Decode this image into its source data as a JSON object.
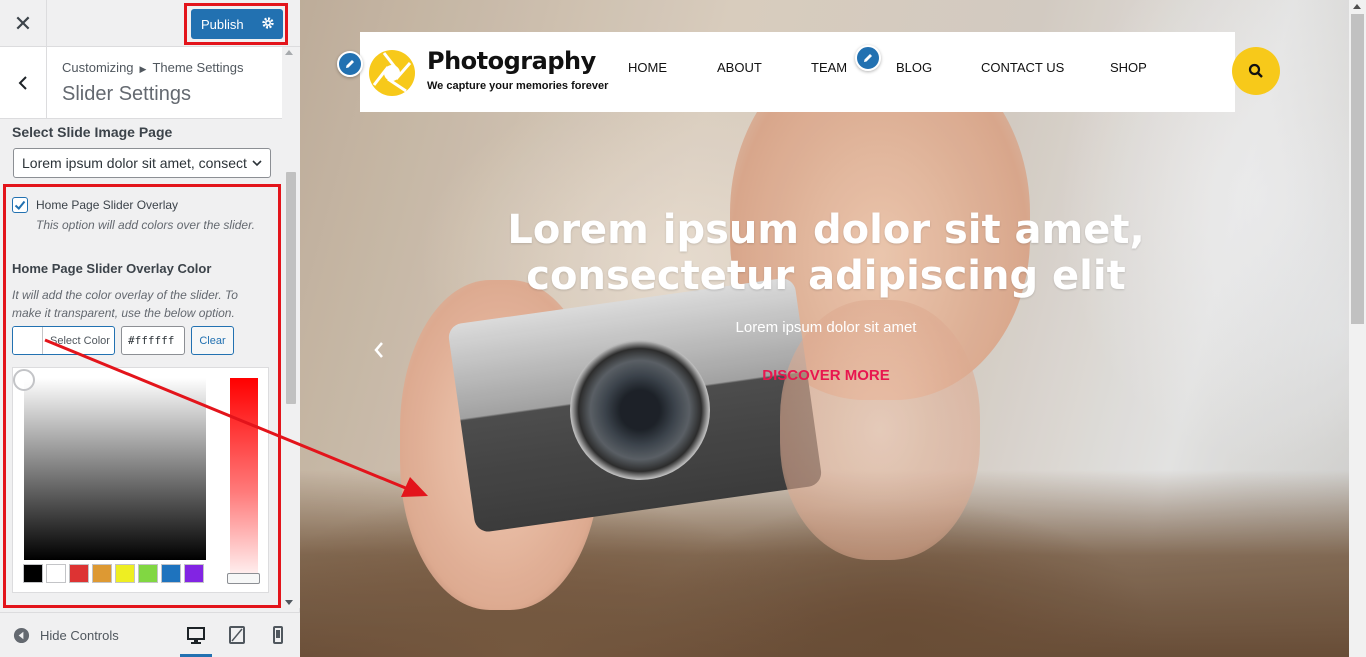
{
  "customizer": {
    "close_icon": "close-icon",
    "publish_label": "Publish",
    "breadcrumb": {
      "root": "Customizing",
      "section": "Theme Settings"
    },
    "section_title": "Slider Settings",
    "slide_page": {
      "label": "Select Slide Image Page",
      "selected": "Lorem ipsum dolor sit amet, consect"
    },
    "overlay_checkbox": {
      "checked": true,
      "label": "Home Page Slider Overlay",
      "description": "This option will add colors over the slider."
    },
    "overlay_color": {
      "label": "Home Page Slider Overlay Color",
      "description": "It will add the color overlay of the slider. To make it transparent, use the below option.",
      "select_color_label": "Select Color",
      "hex_value": "#ffffff",
      "clear_label": "Clear",
      "palette": [
        "#000000",
        "#ffffff",
        "#dd3333",
        "#dd9933",
        "#eeee22",
        "#81d742",
        "#1e73be",
        "#8224e3"
      ]
    },
    "footer": {
      "hide_controls_label": "Hide Controls",
      "devices": [
        "desktop-icon",
        "tablet-icon",
        "mobile-icon"
      ]
    }
  },
  "preview": {
    "site_title": "Photography",
    "site_tagline": "We capture your memories forever",
    "nav": [
      "HOME",
      "ABOUT",
      "TEAM",
      "BLOG",
      "CONTACT US",
      "SHOP"
    ],
    "hero": {
      "title": "Lorem ipsum dolor sit amet, consectetur adipiscing elit",
      "subtitle": "Lorem ipsum dolor sit amet",
      "cta": "DISCOVER MORE"
    },
    "colors": {
      "accent_yellow": "#f7c91a",
      "cta_pink": "#e8164f",
      "wp_blue": "#2271b1",
      "annotation_red": "#e3141b"
    }
  }
}
